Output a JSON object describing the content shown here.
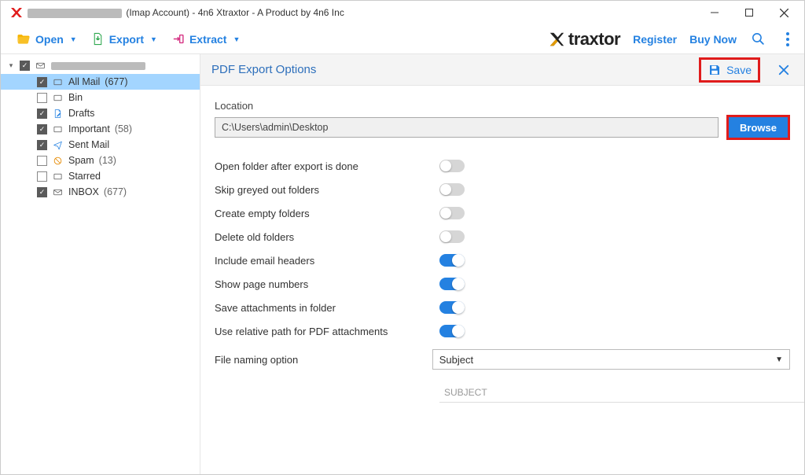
{
  "window": {
    "title_suffix": "(Imap Account) - 4n6 Xtraxtor - A Product by 4n6 Inc"
  },
  "toolbar": {
    "open": "Open",
    "export": "Export",
    "extract": "Extract",
    "brand_text": "traxtor",
    "register": "Register",
    "buy_now": "Buy Now"
  },
  "tree": {
    "items": [
      {
        "label": "All Mail",
        "count": "(677)",
        "checked": true,
        "selected": true,
        "icon": "mailbox"
      },
      {
        "label": "Bin",
        "count": "",
        "checked": false,
        "selected": false,
        "icon": "mailbox"
      },
      {
        "label": "Drafts",
        "count": "",
        "checked": true,
        "selected": false,
        "icon": "draft"
      },
      {
        "label": "Important",
        "count": "(58)",
        "checked": true,
        "selected": false,
        "icon": "mailbox"
      },
      {
        "label": "Sent Mail",
        "count": "",
        "checked": true,
        "selected": false,
        "icon": "sent"
      },
      {
        "label": "Spam",
        "count": "(13)",
        "checked": false,
        "selected": false,
        "icon": "spam"
      },
      {
        "label": "Starred",
        "count": "",
        "checked": false,
        "selected": false,
        "icon": "mailbox"
      },
      {
        "label": "INBOX",
        "count": "(677)",
        "checked": true,
        "selected": false,
        "icon": "envelope"
      }
    ]
  },
  "panel": {
    "title": "PDF Export Options",
    "save": "Save",
    "location_label": "Location",
    "location_value": "C:\\Users\\admin\\Desktop",
    "browse": "Browse",
    "options": [
      {
        "label": "Open folder after export is done",
        "on": false
      },
      {
        "label": "Skip greyed out folders",
        "on": false
      },
      {
        "label": "Create empty folders",
        "on": false
      },
      {
        "label": "Delete old folders",
        "on": false
      },
      {
        "label": "Include email headers",
        "on": true
      },
      {
        "label": "Show page numbers",
        "on": true
      },
      {
        "label": "Save attachments in folder",
        "on": true
      },
      {
        "label": "Use relative path for PDF attachments",
        "on": true
      }
    ],
    "file_naming_label": "File naming option",
    "file_naming_value": "Subject",
    "file_naming_preview": "SUBJECT"
  }
}
